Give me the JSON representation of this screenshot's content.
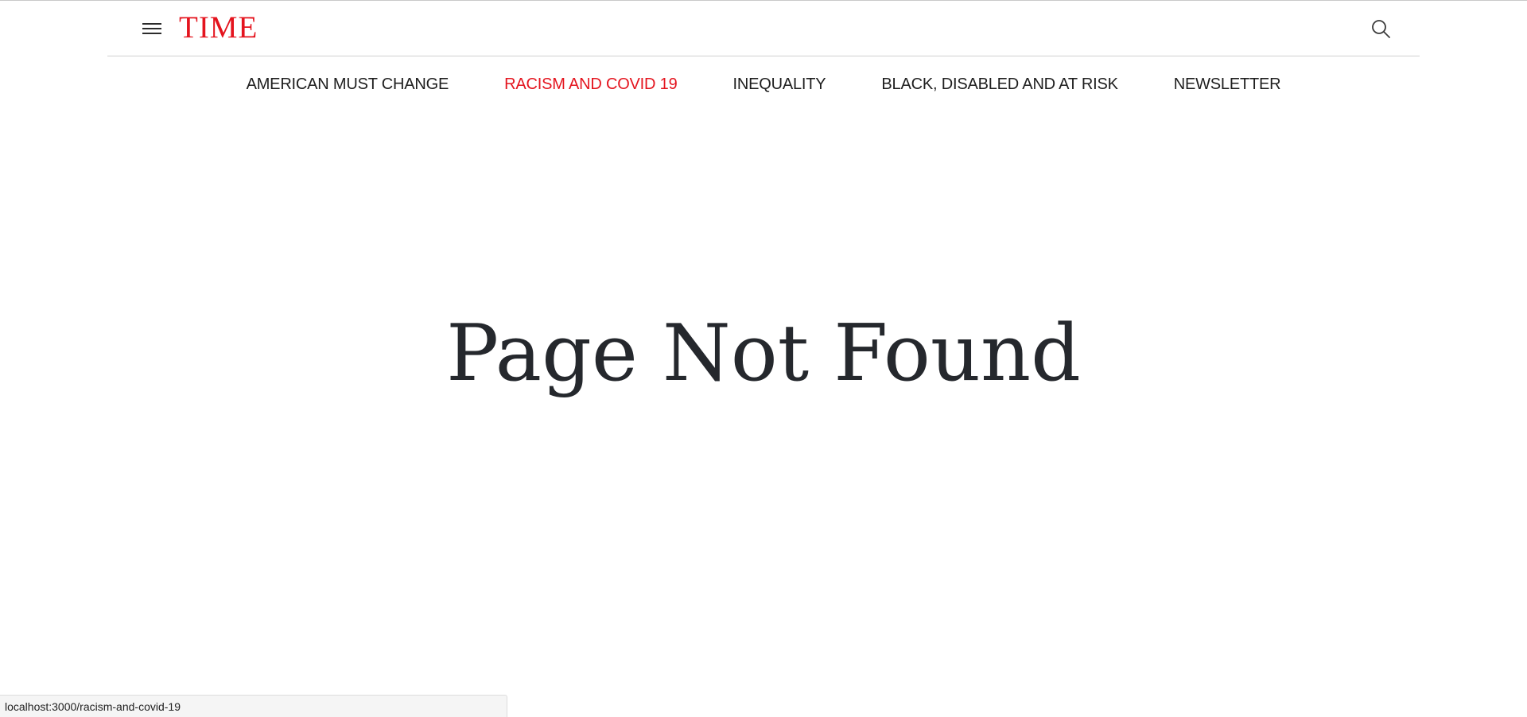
{
  "header": {
    "logo_text": "TIME",
    "logo_color": "#e4141e",
    "menu_icon": "hamburger-menu-icon",
    "search_icon": "search-icon"
  },
  "nav": {
    "items": [
      {
        "label": "AMERICAN MUST CHANGE",
        "active": false
      },
      {
        "label": "RACISM AND COVID 19",
        "active": true
      },
      {
        "label": "INEQUALITY",
        "active": false
      },
      {
        "label": "BLACK, DISABLED AND AT RISK",
        "active": false
      },
      {
        "label": "NEWSLETTER",
        "active": false
      }
    ],
    "active_color": "#e4141e",
    "default_color": "#1e1e1e"
  },
  "main": {
    "title": "Page Not Found"
  },
  "status_bar": {
    "url": "localhost:3000/racism-and-covid-19"
  }
}
